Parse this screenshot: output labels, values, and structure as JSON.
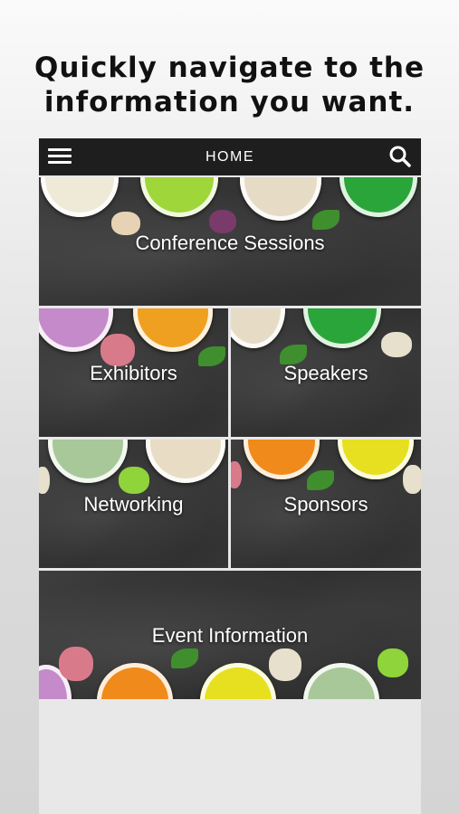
{
  "headline": {
    "line1": "Quickly navigate to the",
    "line2": "information you want."
  },
  "topbar": {
    "title": "HOME",
    "menu_icon": "hamburger-menu-icon",
    "search_icon": "search-icon",
    "background": "#1e1e1e"
  },
  "tiles": [
    {
      "label": "Conference Sessions"
    },
    {
      "label": "Exhibitors"
    },
    {
      "label": "Speakers"
    },
    {
      "label": "Networking"
    },
    {
      "label": "Sponsors"
    },
    {
      "label": "Event Information"
    }
  ]
}
